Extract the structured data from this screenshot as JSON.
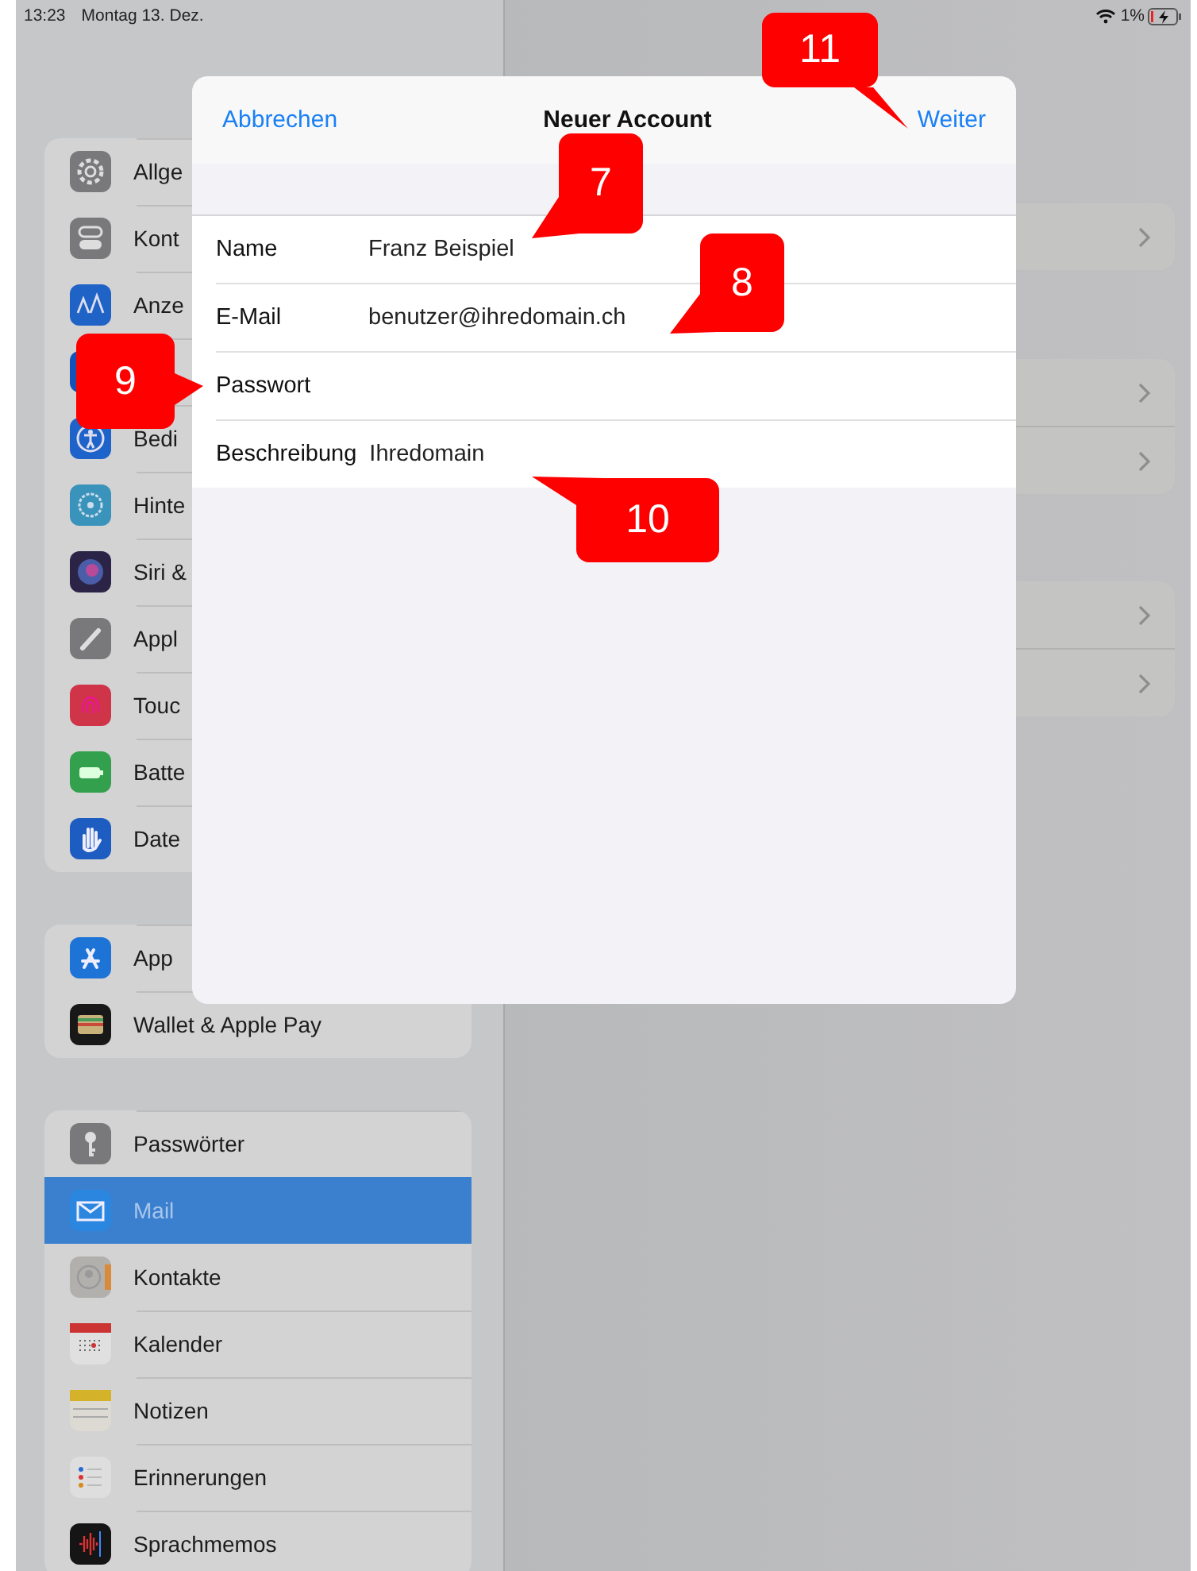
{
  "status_bar": {
    "time": "13:23",
    "date": "Montag 13. Dez.",
    "battery": "1%"
  },
  "sidebar": {
    "groups": [
      {
        "items": [
          {
            "label": "Allge",
            "selected": false
          },
          {
            "label": "Kont",
            "selected": false
          },
          {
            "label": "Anze",
            "selected": false
          },
          {
            "selected": false
          },
          {
            "label": "Bedi",
            "selected": false
          },
          {
            "label": "Hinte",
            "selected": false
          },
          {
            "label": "Siri &",
            "selected": false
          },
          {
            "label": "Appl",
            "selected": false
          },
          {
            "label": "Touc",
            "selected": false
          },
          {
            "label": "Batte",
            "selected": false
          },
          {
            "label": "Date",
            "selected": false
          }
        ]
      },
      {
        "items": [
          {
            "label": "App",
            "selected": false
          },
          {
            "label": "Wallet & Apple Pay",
            "selected": false
          }
        ]
      },
      {
        "items": [
          {
            "label": "Passwörter",
            "selected": false
          },
          {
            "label": "Mail",
            "selected": true
          },
          {
            "label": "Kontakte",
            "selected": false
          },
          {
            "label": "Kalender",
            "selected": false
          },
          {
            "label": "Notizen",
            "selected": false
          },
          {
            "label": "Erinnerungen",
            "selected": false
          },
          {
            "label": "Sprachmemos",
            "selected": false
          }
        ]
      }
    ]
  },
  "sheet": {
    "cancel": "Abbrechen",
    "title": "Neuer Account",
    "next": "Weiter",
    "fields": [
      {
        "label": "Name",
        "value": "Franz Beispiel"
      },
      {
        "label": "E-Mail",
        "value": "benutzer@ihredomain.ch"
      },
      {
        "label": "Passwort"
      },
      {
        "label": "Beschreibung",
        "value": "Ihredomain"
      }
    ]
  },
  "callouts": [
    {
      "number": "11"
    },
    {
      "number": "7"
    },
    {
      "number": "8"
    },
    {
      "number": "9"
    },
    {
      "number": "10"
    }
  ]
}
